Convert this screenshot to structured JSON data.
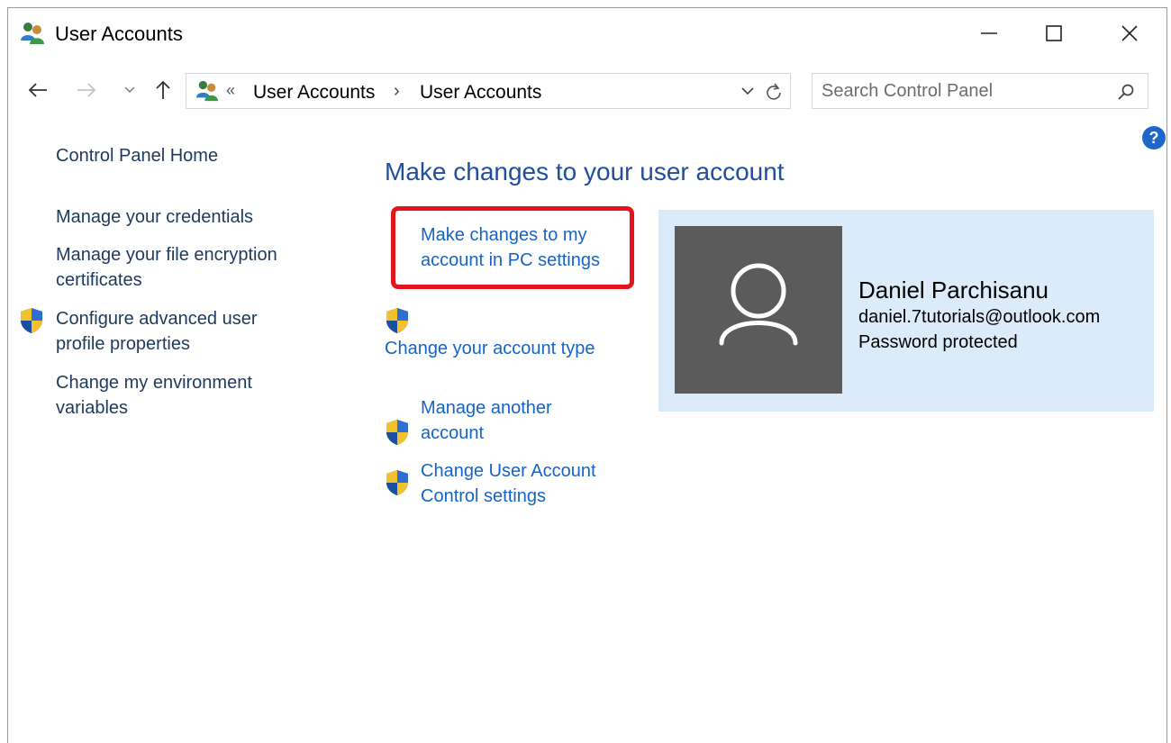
{
  "window": {
    "title": "User Accounts"
  },
  "navigation": {
    "breadcrumb_overflow": "«",
    "breadcrumb": [
      "User Accounts",
      "User Accounts"
    ],
    "breadcrumb_separator": "›",
    "search_placeholder": "Search Control Panel"
  },
  "left_pane": {
    "items": [
      {
        "label": "Control Panel Home",
        "shield": false
      },
      {
        "label": "Manage your credentials",
        "shield": false
      },
      {
        "label_lines": [
          "Manage your file encryption",
          "certificates"
        ],
        "shield": false
      },
      {
        "label_lines": [
          "Configure advanced user",
          "profile properties"
        ],
        "shield": true
      },
      {
        "label_lines": [
          "Change my environment",
          "variables"
        ],
        "shield": false
      }
    ]
  },
  "main": {
    "heading": "Make changes to your user account",
    "tasks": [
      {
        "label_lines": [
          "Make changes to my",
          "account in PC settings"
        ],
        "shield": false,
        "highlighted": true
      },
      {
        "label": "Change your account type",
        "shield": true
      },
      {
        "label_lines": [
          "Manage another",
          "account"
        ],
        "shield": true
      },
      {
        "label_lines": [
          "Change User Account",
          "Control settings"
        ],
        "shield": true
      }
    ]
  },
  "user": {
    "name": "Daniel Parchisanu",
    "email": "daniel.7tutorials@outlook.com",
    "status": "Password protected"
  },
  "colors": {
    "link": "#1663c7",
    "heading": "#1f4f9c",
    "left_link": "#1e395b",
    "user_card_bg": "#dcebfa",
    "avatar_bg": "#5b5b5b",
    "highlight": "#e3141b"
  },
  "icons": [
    "user-accounts-icon",
    "minimize-icon",
    "maximize-icon",
    "close-icon",
    "back-arrow-icon",
    "forward-arrow-icon",
    "recent-chevron-icon",
    "up-arrow-icon",
    "dropdown-chevron-icon",
    "refresh-icon",
    "search-icon",
    "help-icon",
    "uac-shield-icon",
    "user-avatar-icon"
  ]
}
